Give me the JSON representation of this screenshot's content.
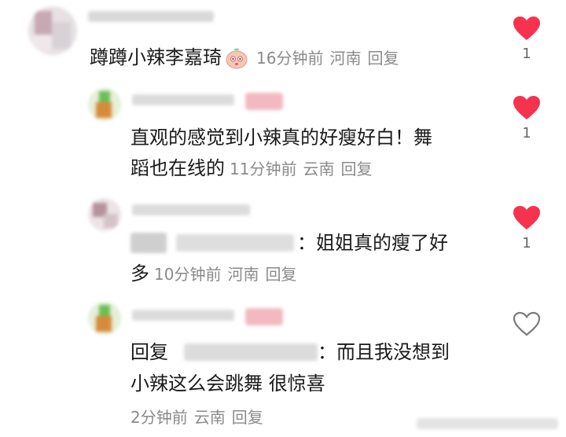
{
  "comments": [
    {
      "text": "蹲蹲小辣李嘉琦",
      "time": "16分钟前",
      "location": "河南",
      "reply_label": "回复",
      "like_count": "1",
      "liked": true
    },
    {
      "text_line1": "直观的感觉到小辣真的好瘦好白！舞",
      "text_line2": "蹈也在线的",
      "time": "11分钟前",
      "location": "云南",
      "reply_label": "回复",
      "like_count": "1",
      "liked": true
    },
    {
      "text_line1": "：姐姐真的瘦了好",
      "text_line2": "多",
      "time": "10分钟前",
      "location": "河南",
      "reply_label": "回复",
      "like_count": "1",
      "liked": true
    },
    {
      "reply_prefix": "回复",
      "text_line1": "：而且我没想到",
      "text_line2": "小辣这么会跳舞 很惊喜",
      "time": "2分钟前",
      "location": "云南",
      "reply_label": "回复",
      "liked": false
    }
  ],
  "colors": {
    "heart_active": "#f5334f",
    "meta_gray": "#8a8a8a"
  }
}
